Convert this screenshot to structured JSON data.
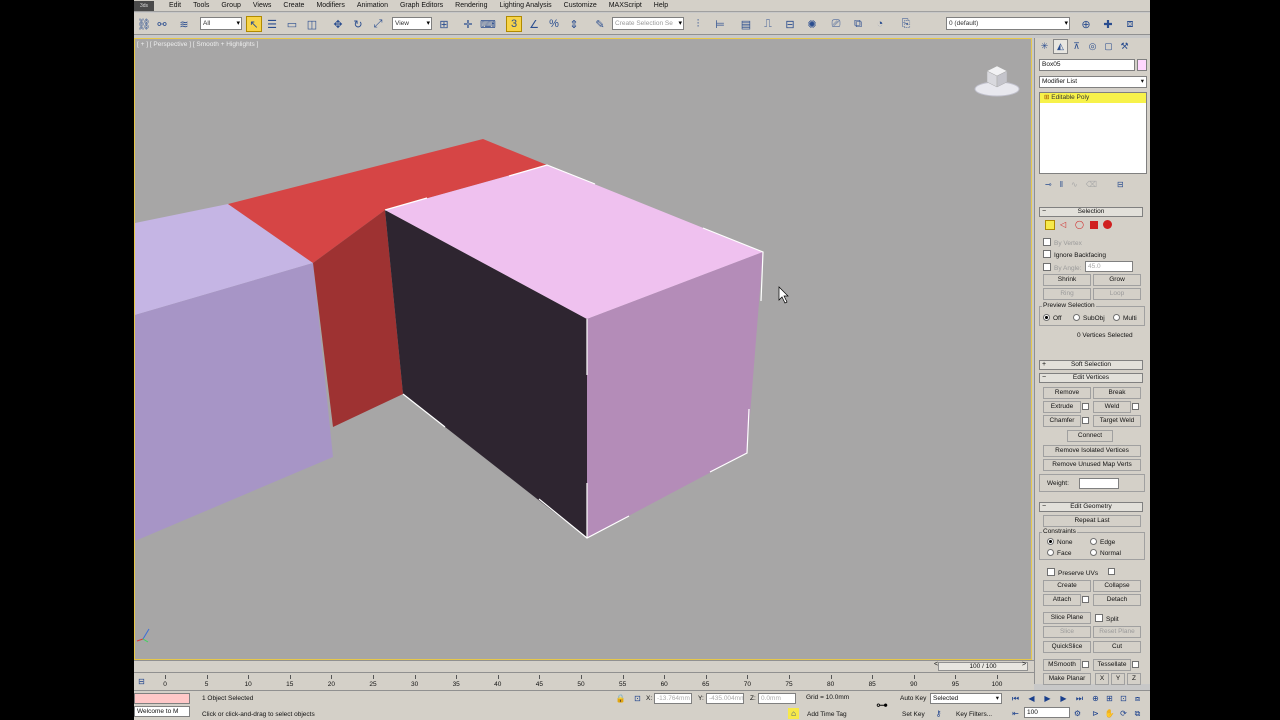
{
  "menubar": {
    "logo": "3ds",
    "items": [
      "Edit",
      "Tools",
      "Group",
      "Views",
      "Create",
      "Modifiers",
      "Animation",
      "Graph Editors",
      "Rendering",
      "Lighting Analysis",
      "Customize",
      "MAXScript",
      "Help"
    ]
  },
  "toolbar": {
    "filter_value": "All",
    "refcoord_value": "View",
    "named_selection_placeholder": "Create Selection Se",
    "layer_value": "0 (default)"
  },
  "viewport": {
    "label": "[ + ] [ Perspective ] [ Smooth + Highlights ]",
    "colors": {
      "background": "#a7a6a6",
      "red_box": "#d64545",
      "selected_box_top": "#efc1ef",
      "selected_box_front": "#b48cb8",
      "selected_box_inner": "#2e2530",
      "left_box_top": "#c5b5e4",
      "left_box_front": "#a795c6"
    }
  },
  "command_panel": {
    "object_name": "Box05",
    "modifier_list": "Modifier List",
    "stack_item": "Editable Poly",
    "selection": {
      "title": "Selection",
      "by_vertex": "By Vertex",
      "ignore_backfacing": "Ignore Backfacing",
      "by_angle": "By Angle:",
      "angle_value": "45.0",
      "shrink": "Shrink",
      "grow": "Grow",
      "ring": "Ring",
      "loop": "Loop",
      "preview_title": "Preview Selection",
      "preview_off": "Off",
      "preview_subobj": "SubObj",
      "preview_multi": "Multi",
      "status": "0 Vertices Selected"
    },
    "soft_selection": {
      "title": "Soft Selection"
    },
    "edit_vertices": {
      "title": "Edit Vertices",
      "remove": "Remove",
      "break": "Break",
      "extrude": "Extrude",
      "weld": "Weld",
      "chamfer": "Chamfer",
      "target_weld": "Target Weld",
      "connect": "Connect",
      "remove_isolated": "Remove Isolated Vertices",
      "remove_unused": "Remove Unused Map Verts",
      "weight": "Weight:"
    },
    "edit_geometry": {
      "title": "Edit Geometry",
      "repeat_last": "Repeat Last",
      "constraints": "Constraints",
      "none": "None",
      "edge": "Edge",
      "face": "Face",
      "normal": "Normal",
      "preserve_uvs": "Preserve UVs",
      "create": "Create",
      "collapse": "Collapse",
      "attach": "Attach",
      "detach": "Detach",
      "slice_plane": "Slice Plane",
      "split": "Split",
      "slice": "Slice",
      "reset_plane": "Reset Plane",
      "quickslice": "QuickSlice",
      "cut": "Cut",
      "msmooth": "MSmooth",
      "tessellate": "Tessellate",
      "make_planar": "Make Planar",
      "x": "X",
      "y": "Y",
      "z": "Z"
    }
  },
  "timeline": {
    "frame_display": "100 / 100",
    "ticks": [
      "0",
      "5",
      "10",
      "15",
      "20",
      "25",
      "30",
      "35",
      "40",
      "45",
      "50",
      "55",
      "60",
      "65",
      "70",
      "75",
      "80",
      "85",
      "90",
      "95",
      "100"
    ]
  },
  "statusbar": {
    "script_listener": "Welcome to M",
    "selection_status": "1 Object Selected",
    "prompt": "Click or click-and-drag to select objects",
    "x_label": "X:",
    "x_value": "-13.764mm",
    "y_label": "Y:",
    "y_value": "-435.004mm",
    "z_label": "Z:",
    "z_value": "0.0mm",
    "grid": "Grid = 10.0mm",
    "add_time_tag": "Add Time Tag",
    "auto_key": "Auto Key",
    "set_key": "Set Key",
    "selected_value": "Selected",
    "key_filters": "Key Filters...",
    "frame_value": "100"
  }
}
